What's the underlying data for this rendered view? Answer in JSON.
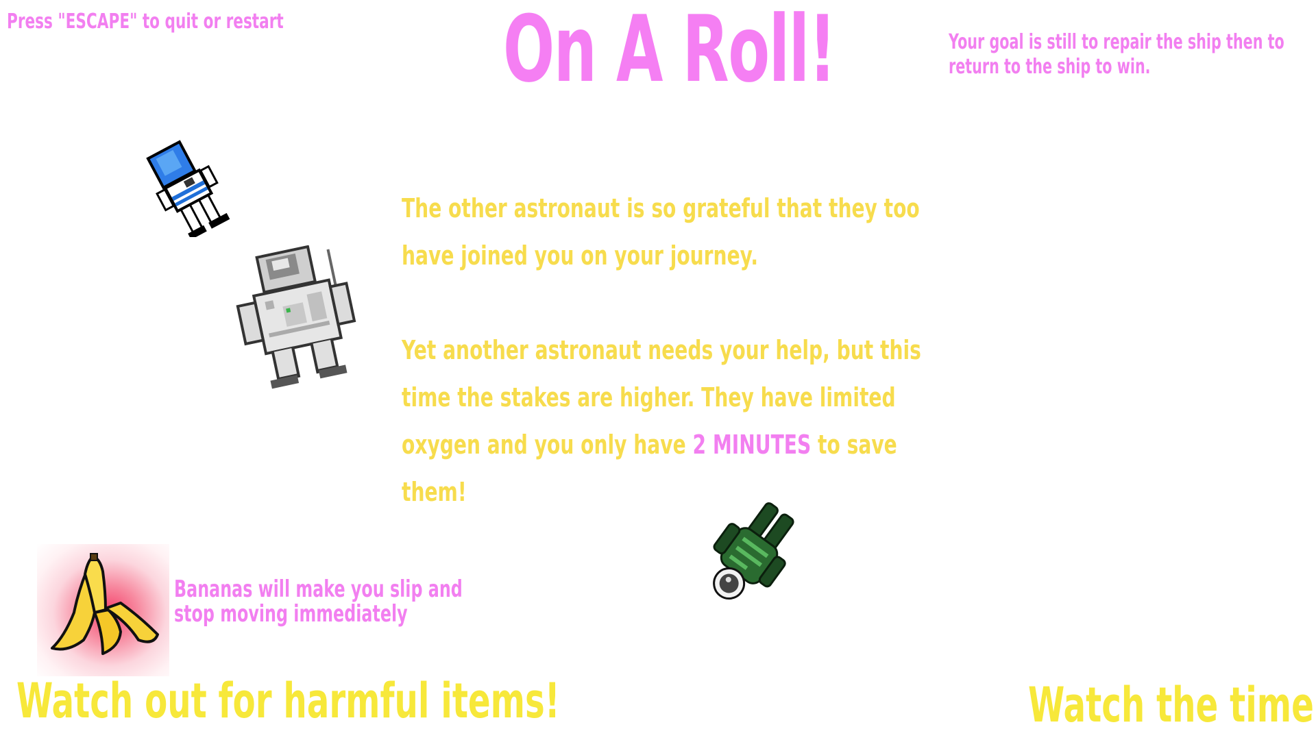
{
  "hints": {
    "escape": "Press \"ESCAPE\" to quit or restart",
    "goal": "Your goal is still to repair the ship then to return to the ship to win."
  },
  "title": "On A Roll!",
  "story": {
    "paragraph1": "The other astronaut is so grateful that they too have joined you on your journey.",
    "paragraph2_before": "Yet another astronaut needs your help, but this time the stakes are higher. They have limited oxygen and you only have ",
    "paragraph2_highlight": "2 MINUTES",
    "paragraph2_after": " to save them!"
  },
  "items": {
    "banana_description": "Bananas will make you slip and stop moving immediately"
  },
  "warnings": {
    "harmful": "Watch out for harmful items!",
    "timer": "Watch the timer!"
  },
  "icons": [
    "blue-astronaut-icon",
    "white-astronaut-icon",
    "green-astronaut-icon",
    "banana-peel-icon"
  ],
  "colors": {
    "pink": "#f27ff0",
    "yellow": "#f7dc4d",
    "bright_yellow": "#f7e83a",
    "background": "#ffffff"
  }
}
